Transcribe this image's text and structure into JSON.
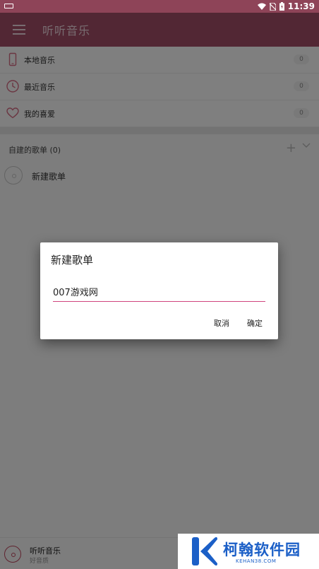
{
  "status_bar": {
    "time": "11:39"
  },
  "app_bar": {
    "title": "听听音乐",
    "icon": "menu-icon"
  },
  "library": [
    {
      "label": "本地音乐",
      "count": "0",
      "icon": "phone-icon"
    },
    {
      "label": "最近音乐",
      "count": "0",
      "icon": "clock-icon"
    },
    {
      "label": "我的喜爱",
      "count": "0",
      "icon": "heart-icon"
    }
  ],
  "playlists": {
    "header": "自建的歌单 (0)",
    "items": [
      {
        "name": "新建歌单",
        "icon": "disc-icon"
      }
    ]
  },
  "player": {
    "title": "听听音乐",
    "subtitle": "好音质"
  },
  "dialog": {
    "title": "新建歌单",
    "input_value": "007游戏网",
    "cancel_label": "取消",
    "ok_label": "确定"
  },
  "watermark": {
    "text": "柯翰软件园",
    "domain": "KEHAN38.COM"
  },
  "colors": {
    "accent": "#a44e68",
    "status_bar": "#8e4458",
    "field_underline": "#d0457d",
    "watermark": "#1b5fc7"
  }
}
